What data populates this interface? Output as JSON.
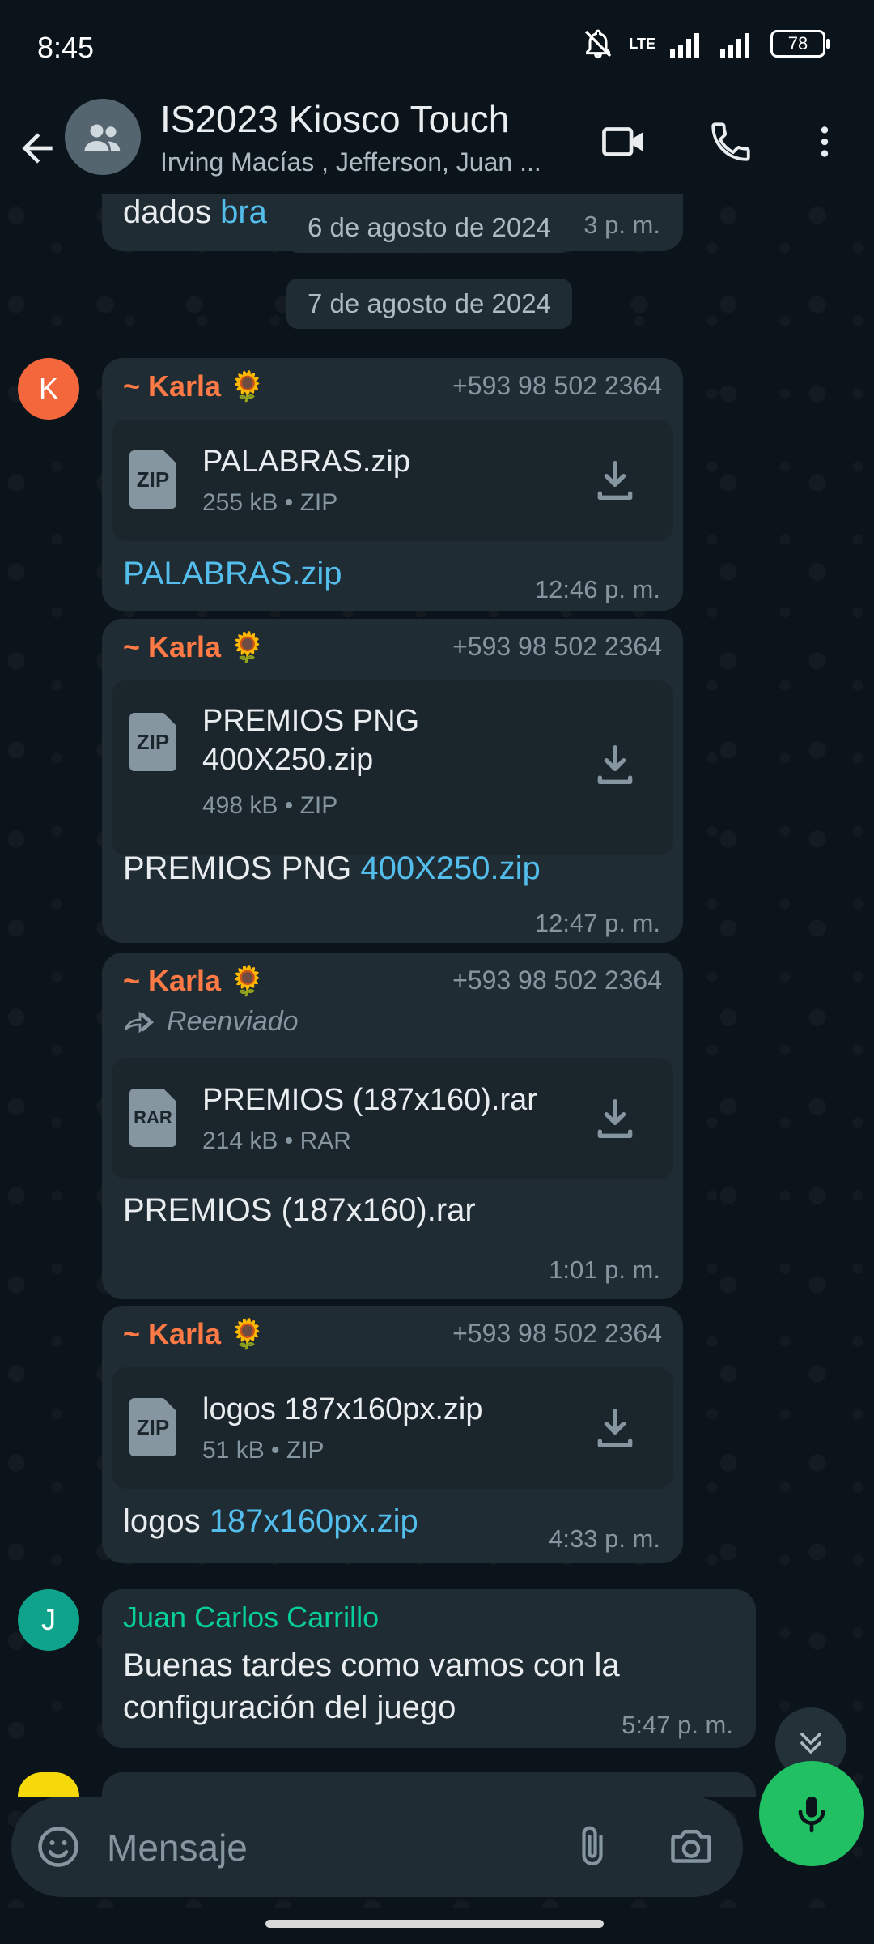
{
  "status": {
    "time": "8:45",
    "network": "LTE",
    "battery": "78",
    "icons": [
      "mute-bell-icon",
      "signal-icon",
      "battery-icon"
    ]
  },
  "header": {
    "title": "IS2023 Kiosco Touch",
    "subtitle": "Irving Macías , Jefferson, Juan ...",
    "icons": [
      "back-arrow-icon",
      "group-avatar-icon",
      "video-call-icon",
      "phone-call-icon",
      "more-vert-icon"
    ]
  },
  "partial_message": {
    "text": "dados ",
    "link": "bra",
    "time": "3 p. m."
  },
  "dates": {
    "first": "6 de agosto de 2024",
    "second": "7 de agosto de 2024"
  },
  "messages": [
    {
      "sender": "~ Karla 🌻",
      "phone": "+593 98 502 2364",
      "file_name": "PALABRAS.zip",
      "file_meta": "255 kB • ZIP",
      "file_type": "ZIP",
      "caption_plain": "",
      "caption_link": "PALABRAS.zip",
      "time": "12:46 p. m."
    },
    {
      "sender": "~ Karla 🌻",
      "phone": "+593 98 502 2364",
      "file_name_line1": "PREMIOS PNG",
      "file_name_line2": "400X250.zip",
      "file_meta": "498 kB • ZIP",
      "file_type": "ZIP",
      "caption_plain": "PREMIOS PNG ",
      "caption_link": "400X250.zip",
      "time": "12:47 p. m."
    },
    {
      "sender": "~ Karla 🌻",
      "phone": "+593 98 502 2364",
      "forwarded": "Reenviado",
      "file_name": "PREMIOS (187x160).rar",
      "file_meta": "214 kB • RAR",
      "file_type": "RAR",
      "caption_plain": "PREMIOS (187x160).rar",
      "time": "1:01 p. m."
    },
    {
      "sender": "~ Karla 🌻",
      "phone": "+593 98 502 2364",
      "file_name": "logos 187x160px.zip",
      "file_meta": "51 kB • ZIP",
      "file_type": "ZIP",
      "caption_plain": "logos ",
      "caption_link": "187x160px.zip",
      "time": "4:33 p. m."
    },
    {
      "sender": "Juan Carlos Carrillo",
      "text_line1": "Buenas tardes como vamos con la",
      "text_line2": "configuración del juego",
      "time": "5:47 p. m."
    }
  ],
  "avatars": {
    "karla": "K",
    "juan": "J",
    "karla_color": "#f4673d",
    "juan_color": "#10a38b"
  },
  "input": {
    "placeholder": "Mensaje"
  },
  "colors": {
    "background": "#0b141a",
    "bubble": "#202c33",
    "link": "#53bdeb",
    "accent_green": "#21c063",
    "sender_orange": "#ff7a45",
    "sender_teal": "#06cf9c"
  }
}
